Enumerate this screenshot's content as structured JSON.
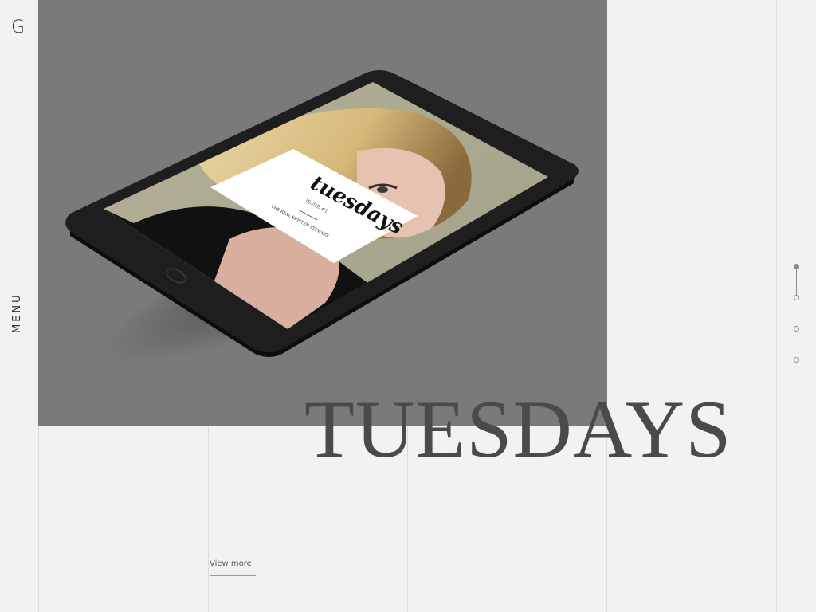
{
  "logo": {
    "letter": "G"
  },
  "menu": {
    "label": "MENU"
  },
  "hero": {
    "title": "TUESDAYS",
    "magazine": {
      "script_title": "tuesdays",
      "issue": "ISSUE #1",
      "subtitle": "THE REAL KRISTEN STEWART"
    }
  },
  "cta": {
    "view_more": "View more"
  },
  "pagination": {
    "count": 4,
    "active_index": 0
  },
  "colors": {
    "hero_bg": "#7a7a7a",
    "page_bg": "#f2f2f2",
    "title": "#4a4a4a"
  }
}
